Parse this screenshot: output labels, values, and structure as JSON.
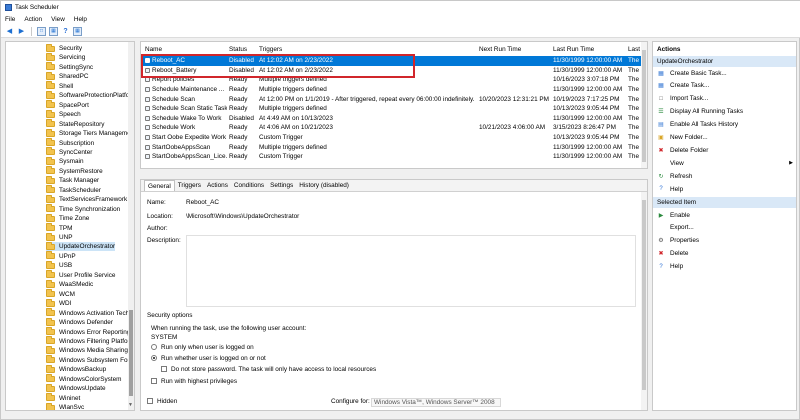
{
  "window": {
    "title": "Task Scheduler"
  },
  "menu": [
    "File",
    "Action",
    "View",
    "Help"
  ],
  "colors": {
    "accent": "#0078d7",
    "highlight": "#d1262b",
    "folder": "#f2c34e",
    "section": "#d9e8f7"
  },
  "tree": [
    "Security",
    "Servicing",
    "SettingSync",
    "SharedPC",
    "Shell",
    "SoftwareProtectionPlatform",
    "SpacePort",
    "Speech",
    "StateRepository",
    "Storage Tiers Managemen",
    "Subscription",
    "SyncCenter",
    "Sysmain",
    "SystemRestore",
    "Task Manager",
    "TaskScheduler",
    "TextServicesFramework",
    "Time Synchronization",
    "Time Zone",
    "TPM",
    "UNP",
    "UpdateOrchestrator",
    "UPnP",
    "USB",
    "User Profile Service",
    "WaaSMedic",
    "WCM",
    "WDI",
    "Windows Activation Techn",
    "Windows Defender",
    "Windows Error Reporting",
    "Windows Filtering Platform",
    "Windows Media Sharing",
    "Windows Subsystem For Li",
    "WindowsBackup",
    "WindowsColorSystem",
    "WindowsUpdate",
    "Wininet",
    "WlanSvc"
  ],
  "tree_selected": "UpdateOrchestrator",
  "columns": [
    "Name",
    "Status",
    "Triggers",
    "Next Run Time",
    "Last Run Time",
    "Last"
  ],
  "tasks": [
    [
      "Reboot_AC",
      "Disabled",
      "At 12:02 AM on 2/23/2022",
      "",
      "11/30/1999 12:00:00 AM",
      "The"
    ],
    [
      "Reboot_Battery",
      "Disabled",
      "At 12:02 AM on 2/23/2022",
      "",
      "11/30/1999 12:00:00 AM",
      "The"
    ],
    [
      "Report policies",
      "Ready",
      "Multiple triggers defined",
      "",
      "10/16/2023 3:07:18 PM",
      "The"
    ],
    [
      "Schedule Maintenance ...",
      "Ready",
      "Multiple triggers defined",
      "",
      "11/30/1999 12:00:00 AM",
      "The"
    ],
    [
      "Schedule Scan",
      "Ready",
      "At 12:00 PM on 1/1/2019 - After triggered, repeat every 06:00:00 indefinitely.",
      "10/20/2023 12:31:21 PM",
      "10/19/2023 7:17:25 PM",
      "The"
    ],
    [
      "Schedule Scan Static Task",
      "Ready",
      "Multiple triggers defined",
      "",
      "10/13/2023 9:05:44 PM",
      "The"
    ],
    [
      "Schedule Wake To Work",
      "Disabled",
      "At 4:49 AM on 10/13/2023",
      "",
      "11/30/1999 12:00:00 AM",
      "The"
    ],
    [
      "Schedule Work",
      "Ready",
      "At 4:06 AM on 10/21/2023",
      "10/21/2023 4:06:00 AM",
      "3/15/2023 8:26:47 PM",
      "The"
    ],
    [
      "Start Oobe Expedite Work",
      "Ready",
      "Custom Trigger",
      "",
      "10/13/2023 9:05:44 PM",
      "The"
    ],
    [
      "StartOobeAppsScan",
      "Ready",
      "Multiple triggers defined",
      "",
      "11/30/1999 12:00:00 AM",
      "The"
    ],
    [
      "StartOobeAppsScan_Lice...",
      "Ready",
      "Custom Trigger",
      "",
      "11/30/1999 12:00:00 AM",
      "The"
    ]
  ],
  "selected_task_index": 0,
  "detail_tabs": [
    "General",
    "Triggers",
    "Actions",
    "Conditions",
    "Settings",
    "History (disabled)"
  ],
  "general": {
    "name_label": "Name:",
    "name_value": "Reboot_AC",
    "location_label": "Location:",
    "location_value": "\\Microsoft\\Windows\\UpdateOrchestrator",
    "author_label": "Author:",
    "description_label": "Description:",
    "security_title": "Security options",
    "account_prompt": "When running the task, use the following user account:",
    "account": "SYSTEM",
    "opt_logged_on": "Run only when user is logged on",
    "opt_whether": "Run whether user is logged on or not",
    "opt_no_password": "Do not store password.  The task will only have access to local resources",
    "opt_highest": "Run with highest privileges",
    "hidden_label": "Hidden",
    "configure_label": "Configure for:",
    "configure_value": "Windows Vista™, Windows Server™ 2008"
  },
  "actions_pane": {
    "header": "Actions",
    "section1": "UpdateOrchestrator",
    "items1": [
      {
        "label": "Create Basic Task...",
        "icon": "create-basic-task-icon"
      },
      {
        "label": "Create Task...",
        "icon": "create-task-icon"
      },
      {
        "label": "Import Task...",
        "icon": "import-icon"
      },
      {
        "label": "Display All Running Tasks",
        "icon": "running-tasks-icon"
      },
      {
        "label": "Enable All Tasks History",
        "icon": "history-icon"
      },
      {
        "label": "New Folder...",
        "icon": "new-folder-icon"
      },
      {
        "label": "Delete Folder",
        "icon": "delete-icon"
      },
      {
        "label": "View",
        "icon": ""
      },
      {
        "label": "Refresh",
        "icon": "refresh-icon"
      },
      {
        "label": "Help",
        "icon": "help-icon"
      }
    ],
    "section2": "Selected Item",
    "items2": [
      {
        "label": "Enable",
        "icon": "enable-icon"
      },
      {
        "label": "Export...",
        "icon": ""
      },
      {
        "label": "Properties",
        "icon": "properties-icon"
      },
      {
        "label": "Delete",
        "icon": "delete-icon"
      },
      {
        "label": "Help",
        "icon": "help-icon"
      }
    ]
  }
}
